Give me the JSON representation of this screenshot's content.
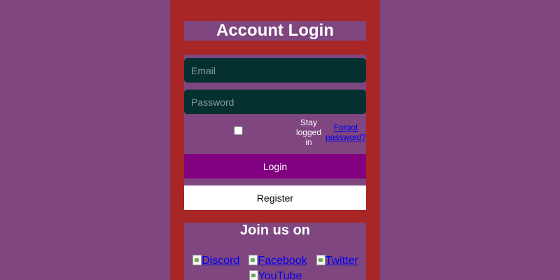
{
  "header": {
    "title": "Account Login"
  },
  "form": {
    "email_placeholder": "Email",
    "password_placeholder": "Password",
    "remember_label": "Stay logged in",
    "remember_checked": false,
    "forgot_label": "Forgot password?",
    "login_label": "Login",
    "register_label": "Register"
  },
  "social": {
    "heading": "Join us on",
    "links": [
      {
        "label": "Discord",
        "icon": "broken-image-icon"
      },
      {
        "label": "Facebook",
        "icon": "broken-image-icon"
      },
      {
        "label": "Twitter",
        "icon": "broken-image-icon"
      },
      {
        "label": "YouTube",
        "icon": "broken-image-icon"
      }
    ]
  },
  "colors": {
    "page_background": "#7f4680",
    "panel_background": "#a82626",
    "input_background": "#043030",
    "login_button": "#800080",
    "register_button": "#ffffff",
    "link": "#0000ee"
  }
}
